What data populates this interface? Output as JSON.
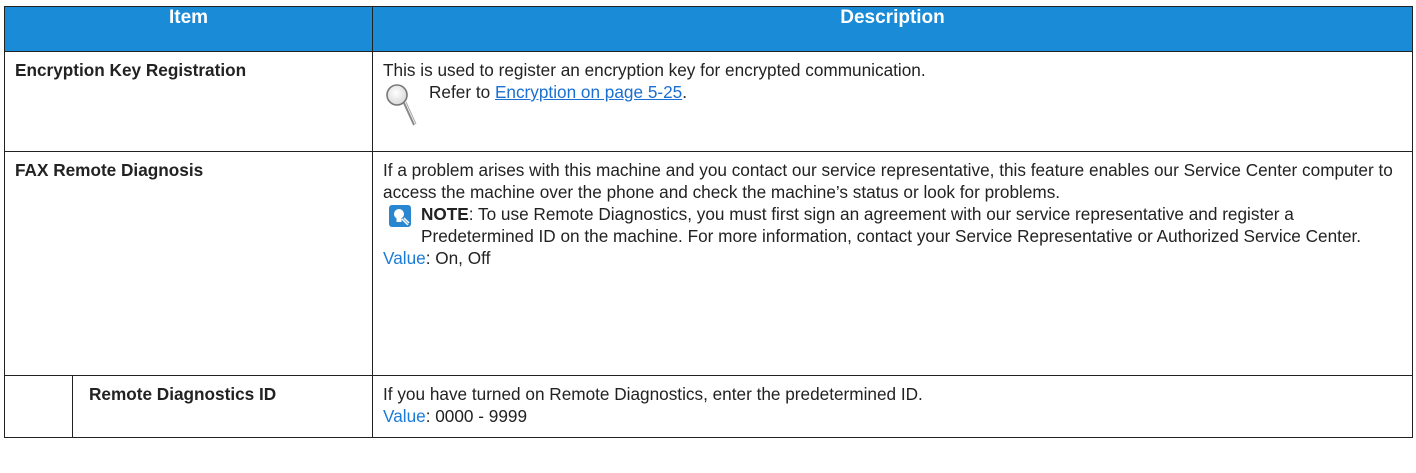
{
  "header": {
    "item": "Item",
    "description": "Description"
  },
  "rows": [
    {
      "item": "Encryption Key Registration",
      "description": "This is used to register an encryption key for encrypted communication.",
      "ref_prefix": "Refer to ",
      "ref_link": "Encryption on page 5-25",
      "ref_suffix": "."
    },
    {
      "item": "FAX Remote Diagnosis",
      "description": "If a problem arises with this machine and you contact our service representative, this feature enables our Service Center computer to access the machine over the phone and check the machine’s status or look for problems.",
      "note_label": "NOTE",
      "note_text": ": To use Remote Diagnostics, you must first sign an agreement with our service representative and register a Predetermined ID on the machine. For more information, contact your Service Representative or Authorized Service Center.",
      "value_label": "Value",
      "value_text": ": On, Off"
    },
    {
      "item": "Remote Diagnostics ID",
      "description": "If you have turned on Remote Diagnostics, enter the predetermined ID.",
      "value_label": "Value",
      "value_text": ": 0000 - 9999"
    }
  ],
  "icons": {
    "reference": "magnifier-icon",
    "note": "note-lightbulb-icon"
  },
  "colors": {
    "header_bg": "#1a8bd6",
    "header_text": "#ffffff",
    "value_label": "#1a7bd8",
    "link": "#1a6fd0"
  }
}
